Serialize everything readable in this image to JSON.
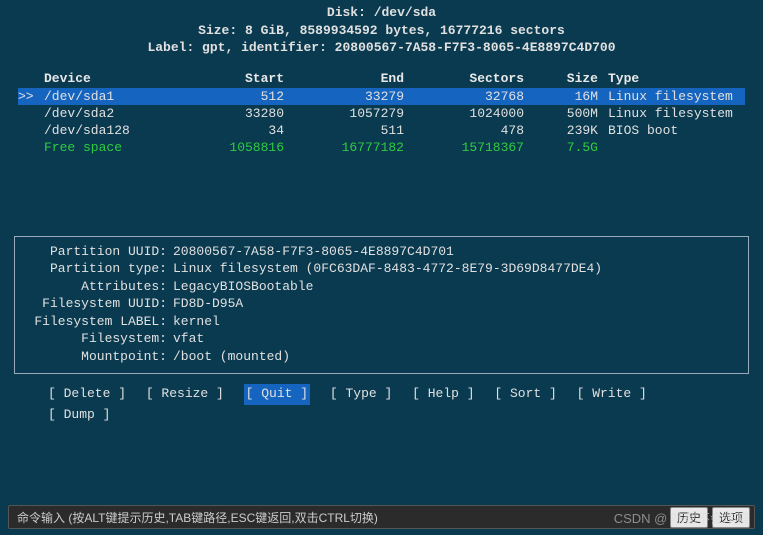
{
  "header": {
    "disk_line": "Disk: /dev/sda",
    "size_line": "Size: 8 GiB, 8589934592 bytes, 16777216 sectors",
    "label_line": "Label: gpt, identifier: 20800567-7A58-F7F3-8065-4E8897C4D700"
  },
  "columns": {
    "device": "Device",
    "start": "Start",
    "end": "End",
    "sectors": "Sectors",
    "size": "Size",
    "type": "Type"
  },
  "rows": [
    {
      "mark": ">>",
      "device": "/dev/sda1",
      "start": "512",
      "end": "33279",
      "sectors": "32768",
      "size": "16M",
      "type": "Linux filesystem",
      "selected": true
    },
    {
      "mark": "",
      "device": "/dev/sda2",
      "start": "33280",
      "end": "1057279",
      "sectors": "1024000",
      "size": "500M",
      "type": "Linux filesystem"
    },
    {
      "mark": "",
      "device": "/dev/sda128",
      "start": "34",
      "end": "511",
      "sectors": "478",
      "size": "239K",
      "type": "BIOS boot"
    },
    {
      "mark": "",
      "device": "Free space",
      "start": "1058816",
      "end": "16777182",
      "sectors": "15718367",
      "size": "7.5G",
      "type": "",
      "free": true
    }
  ],
  "details": {
    "partition_uuid": {
      "k": "Partition UUID:",
      "v": "20800567-7A58-F7F3-8065-4E8897C4D701"
    },
    "partition_type": {
      "k": "Partition type:",
      "v": "Linux filesystem (0FC63DAF-8483-4772-8E79-3D69D8477DE4)"
    },
    "attributes": {
      "k": "Attributes:",
      "v": "LegacyBIOSBootable"
    },
    "fs_uuid": {
      "k": "Filesystem UUID:",
      "v": "FD8D-D95A"
    },
    "fs_label": {
      "k": "Filesystem LABEL:",
      "v": "kernel"
    },
    "filesystem": {
      "k": "Filesystem:",
      "v": "vfat"
    },
    "mountpoint": {
      "k": "Mountpoint:",
      "v": "/boot (mounted)"
    }
  },
  "menu": {
    "delete": "[ Delete ]",
    "resize": "[ Resize ]",
    "quit": "[  Quit  ]",
    "type": "[  Type  ]",
    "help": "[  Help  ]",
    "sort": "[  Sort  ]",
    "write": "[  Write ]",
    "dump": "[  Dump  ]"
  },
  "bottombar": {
    "hint": "命令输入 (按ALT键提示历史,TAB键路径,ESC键返回,双击CTRL切换)",
    "history": "历史",
    "options": "选项"
  },
  "watermark": "CSDN @ 啥都不会难搞"
}
